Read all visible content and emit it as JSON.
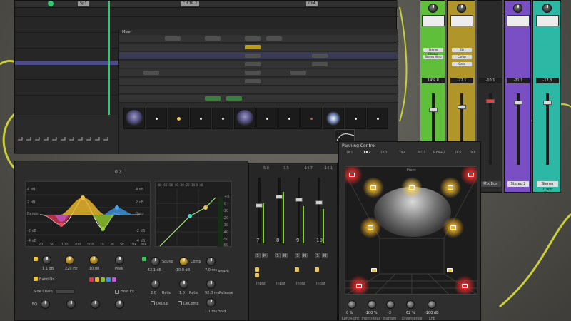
{
  "arrange": {
    "markers": [
      "Sp1",
      "CH TR 2",
      "Ch4"
    ],
    "mixer_title": "Mixer",
    "gain_label": "0.3"
  },
  "eq": {
    "title": "0.3",
    "eq_left_scale": [
      "4 dB",
      "2 dB",
      "0 dB",
      "-2 dB",
      "-4 dB"
    ],
    "eq_right_scale": [
      "4 dB",
      "2 dB",
      "0 dB",
      "-2 dB",
      "-4 dB"
    ],
    "eq_freqs": [
      "20",
      "50",
      "100",
      "200",
      "500",
      "1k",
      "2k",
      "5k",
      "10k",
      "20k"
    ],
    "eq_band_label": "Bands",
    "eq_gain_label": "Gain",
    "comp_top_scale": "-80 -60 -50 -40 -30 -20 -10 0 +6",
    "comp_right_scale": [
      "+6",
      "0",
      "-10",
      "-20",
      "-30",
      "-40",
      "-50",
      "-60"
    ],
    "knobs": [
      {
        "label": "Gain",
        "value": "1.1 dB"
      },
      {
        "label": "Freq",
        "value": "220 Hz"
      },
      {
        "label": "Q",
        "value": "10.00"
      },
      {
        "label": "Peak",
        "value": ""
      }
    ],
    "dyn_knobs": [
      {
        "label": "Sound",
        "value": "-42.1 dB"
      },
      {
        "label": "Comp",
        "value": "-10.0 dB"
      },
      {
        "label": "Attack",
        "value": "7.0 ms"
      },
      {
        "label": "Ratio",
        "value": "2.0"
      },
      {
        "label": "Ratio",
        "value": "1.0"
      },
      {
        "label": "Release",
        "value": "92.0 ms"
      },
      {
        "label": "Hold",
        "value": "1.1 ms"
      }
    ],
    "band_on": "Band On",
    "side_chain": "Side Chain",
    "host_fx": "Host Fx",
    "eq_label": "EQ",
    "dedup": "DeDup",
    "dechorus": "DeComp"
  },
  "strips": {
    "numbers": [
      "7",
      "8",
      "9",
      "10"
    ],
    "gains": [
      "5.8",
      "3.5",
      "-14.7",
      "-14.1"
    ],
    "solo": "S",
    "mute": "M",
    "input": "Input"
  },
  "panning": {
    "title": "Panning Control",
    "tabs": [
      "TK1",
      "TK2",
      "TK3",
      "TK4",
      "MO1",
      "RFA+2",
      "TK5",
      "TK6"
    ],
    "active_tab": "TK2",
    "knobs": [
      {
        "label": "Left/Right",
        "value": "0 %"
      },
      {
        "label": "Front/Rear",
        "value": "-100 %"
      },
      {
        "label": "Bottom",
        "value": "-3"
      },
      {
        "label": "Divergence",
        "value": "62 %"
      },
      {
        "label": "LFE",
        "value": "-100 dB"
      }
    ],
    "room_label": "Front"
  },
  "color_strips": [
    {
      "name": "",
      "pan": "14% R",
      "color": "#5fbf3a"
    },
    {
      "name": "",
      "pan": "-22.1",
      "color": "#b0952b"
    },
    {
      "name": "Mix Bus",
      "pan": "-10.1",
      "color": "#3a3a3a"
    },
    {
      "name": "Stereo 2",
      "pan": "-21.1",
      "color": "#7b4fc4"
    },
    {
      "name": "Stereo 2_wyr",
      "pan": "-17.3",
      "color": "#2db8a6"
    }
  ],
  "mixer_strip_labels": {
    "sends": [
      "Stereo Chorus",
      "Stereo Verb",
      "Delay"
    ],
    "inserts": [
      "EQ",
      "Comp",
      "Gate"
    ]
  }
}
